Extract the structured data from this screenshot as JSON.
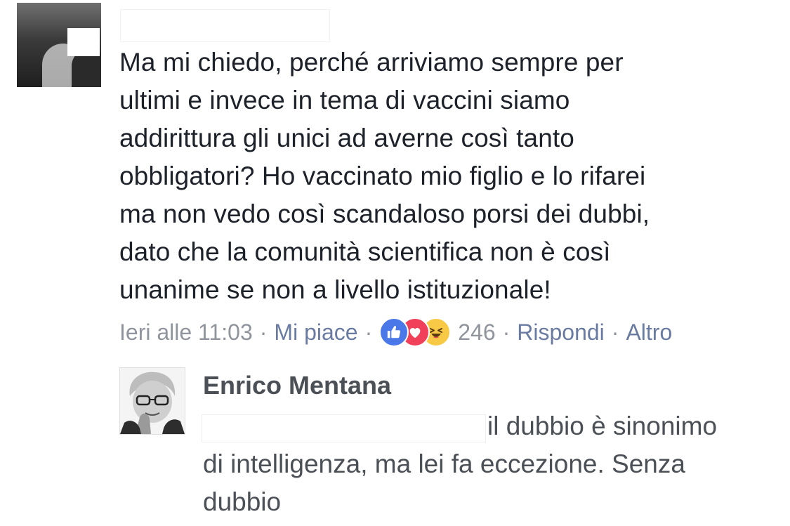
{
  "comment": {
    "author_name": "",
    "lines": [
      "Ma mi chiedo, perché arriviamo sempre per",
      "ultimi e invece in tema di vaccini siamo",
      "addirittura gli unici ad averne così tanto",
      "obbligatori? Ho vaccinato mio figlio e lo rifarei",
      "ma non vedo così scandaloso porsi dei dubbi,",
      "dato che la comunità scientifica non è così",
      "unanime se non a livello istituzionale!"
    ],
    "meta": {
      "timestamp": "Ieri alle 11:03",
      "separator": "·",
      "like_label": "Mi piace",
      "reaction_icons": [
        "like-icon",
        "love-icon",
        "haha-icon"
      ],
      "reaction_count": "246",
      "reply_label": "Rispondi",
      "more_label": "Altro"
    }
  },
  "reply": {
    "author_name": "Enrico Mentana",
    "lines": [
      "il dubbio è sinonimo",
      "di intelligenza, ma lei fa eccezione. Senza",
      "dubbio"
    ]
  },
  "colors": {
    "text_primary": "#1d2129",
    "text_secondary": "#4b4f56",
    "meta_gray": "#90949c",
    "link_blue": "#6a7ba2",
    "like_blue": "#4a78e8",
    "love_red": "#f0405a",
    "haha_yellow": "#f7c945"
  }
}
